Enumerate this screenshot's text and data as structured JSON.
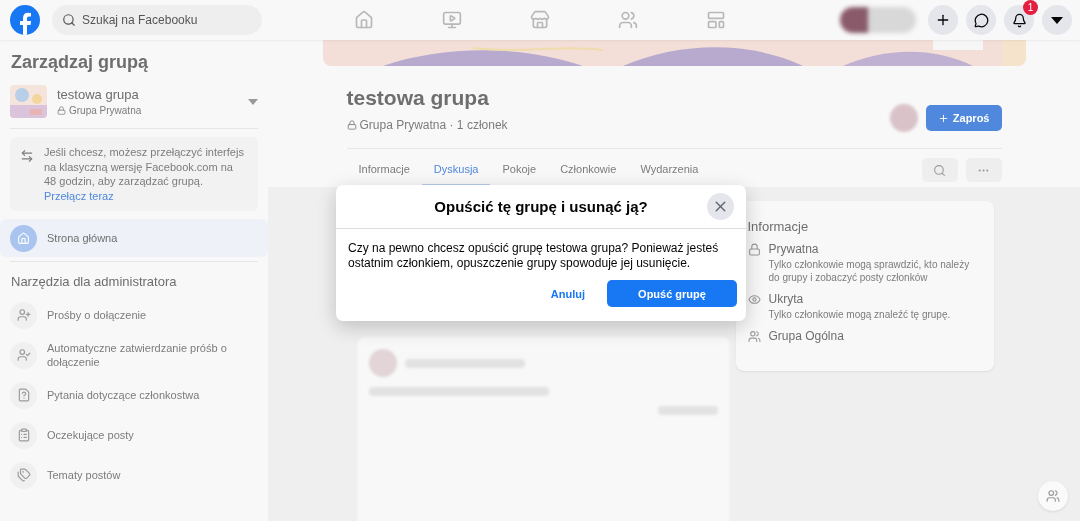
{
  "topbar": {
    "search": {
      "placeholder": "Szukaj na Facebooku"
    },
    "notifications_badge": "1"
  },
  "sidebar": {
    "title": "Zarządzaj grupą",
    "group": {
      "name": "testowa grupa",
      "privacy": "Grupa Prywatna"
    },
    "notice": {
      "text": "Jeśli chcesz, możesz przełączyć interfejs na klasyczną wersję Facebook.com na 48 godzin, aby zarządzać grupą.",
      "link": "Przełącz teraz"
    },
    "home": {
      "label": "Strona główna",
      "selected": true
    },
    "tools_heading": "Narzędzia dla administratora",
    "tools": [
      {
        "kind": "requests",
        "label": "Prośby o dołączenie"
      },
      {
        "kind": "auto",
        "label": "Automatyczne zatwierdzanie próśb o dołączenie"
      },
      {
        "kind": "questions",
        "label": "Pytania dotyczące członkostwa"
      },
      {
        "kind": "pending",
        "label": "Oczekujące posty"
      },
      {
        "kind": "topics",
        "label": "Tematy postów"
      }
    ]
  },
  "group": {
    "title": "testowa grupa",
    "meta": "Grupa Prywatna · 1 członek",
    "invite": "Zaproś",
    "tabs": [
      {
        "label": "Informacje",
        "selected": false
      },
      {
        "label": "Dyskusja",
        "selected": true
      },
      {
        "label": "Pokoje",
        "selected": false
      },
      {
        "label": "Członkowie",
        "selected": false
      },
      {
        "label": "Wydarzenia",
        "selected": false
      }
    ]
  },
  "about": {
    "title": "Informacje",
    "items": [
      {
        "kind": "private",
        "title": "Prywatna",
        "description": "Tylko członkowie mogą sprawdzić, kto należy do grupy i zobaczyć posty członków"
      },
      {
        "kind": "hidden",
        "title": "Ukryta",
        "description": "Tylko członkowie mogą znaleźć tę grupę."
      },
      {
        "kind": "general",
        "title": "Grupa Ogólna"
      }
    ]
  },
  "dialog": {
    "title": "Opuścić tę grupę i usunąć ją?",
    "body": "Czy na pewno chcesz opuścić grupę testowa grupa? Ponieważ jesteś ostatnim członkiem, opuszczenie grupy spowoduje jej usunięcie.",
    "cancel": "Anuluj",
    "confirm": "Opuść grupę"
  }
}
